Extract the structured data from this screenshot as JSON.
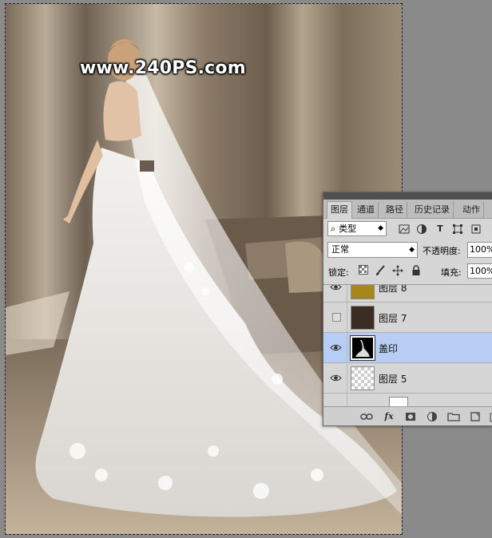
{
  "watermark": "www.240PS.com",
  "panel": {
    "tabs": [
      "图层",
      "通道",
      "路径",
      "历史记录",
      "动作"
    ],
    "filter": {
      "label": "类型",
      "search_icon": "search-icon"
    },
    "blend_mode": "正常",
    "opacity_label": "不透明度:",
    "opacity_value": "100%",
    "lock_label": "锁定:",
    "fill_label": "填充:",
    "fill_value": "100%",
    "layers": [
      {
        "name": "图层 8",
        "visible": true,
        "selected": false,
        "thumb_color": "#a7861a"
      },
      {
        "name": "图层 7",
        "visible": false,
        "selected": false,
        "thumb_color": "#3a2d24"
      },
      {
        "name": "盖印",
        "visible": true,
        "selected": true,
        "thumb_color": "#000000"
      },
      {
        "name": "图层 5",
        "visible": true,
        "selected": false,
        "thumb_color": "transparent"
      },
      {
        "name": "",
        "visible": false,
        "selected": false,
        "thumb_color": "#ffffff"
      }
    ]
  },
  "colors": {
    "selection": "#b7cdf3",
    "panel_bg": "#d6d6d6",
    "app_bg": "#8a8a8a"
  }
}
